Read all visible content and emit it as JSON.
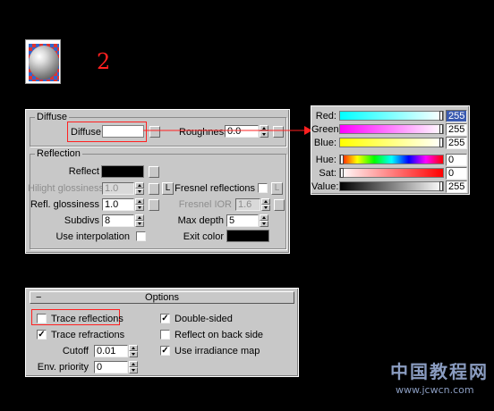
{
  "step_number": "2",
  "colors": {
    "annotation": "#ff2020",
    "panel": "#c8c8c8",
    "diffuse_swatch": "#ffffff",
    "reflect_swatch": "#000000",
    "exit_swatch": "#000000"
  },
  "material_preview": {
    "icon": "sphere-material-icon"
  },
  "basic": {
    "diffuse_group_title": "Diffuse",
    "diffuse_label": "Diffuse",
    "roughness_label": "Roughness",
    "roughness_value": "0.0"
  },
  "reflection": {
    "group_title": "Reflection",
    "reflect_label": "Reflect",
    "hilight_glossiness_label": "Hilight glossiness",
    "hilight_glossiness_value": "1.0",
    "refl_glossiness_label": "Refl. glossiness",
    "refl_glossiness_value": "1.0",
    "subdivs_label": "Subdivs",
    "subdivs_value": "8",
    "use_interpolation_label": "Use interpolation",
    "fresnel_reflections_label": "Fresnel reflections",
    "fresnel_ior_label": "Fresnel IOR",
    "fresnel_ior_value": "1.6",
    "max_depth_label": "Max depth",
    "max_depth_value": "5",
    "exit_color_label": "Exit color",
    "lock_label": "L"
  },
  "color_picker": {
    "red_label": "Red:",
    "red_value": "255",
    "green_label": "Green:",
    "green_value": "255",
    "blue_label": "Blue:",
    "blue_value": "255",
    "hue_label": "Hue:",
    "hue_value": "0",
    "sat_label": "Sat:",
    "sat_value": "0",
    "value_label": "Value:",
    "value_value": "255"
  },
  "options": {
    "title": "Options",
    "collapse_symbol": "−",
    "trace_reflections_label": "Trace reflections",
    "trace_reflections_checked": false,
    "trace_refractions_label": "Trace refractions",
    "trace_refractions_checked": true,
    "cutoff_label": "Cutoff",
    "cutoff_value": "0.01",
    "env_priority_label": "Env. priority",
    "env_priority_value": "0",
    "double_sided_label": "Double-sided",
    "double_sided_checked": true,
    "reflect_back_side_label": "Reflect on back side",
    "reflect_back_side_checked": false,
    "use_irradiance_map_label": "Use irradiance map",
    "use_irradiance_map_checked": true
  },
  "watermark": {
    "title": "中国教程网",
    "url": "www.jcwcn.com"
  }
}
